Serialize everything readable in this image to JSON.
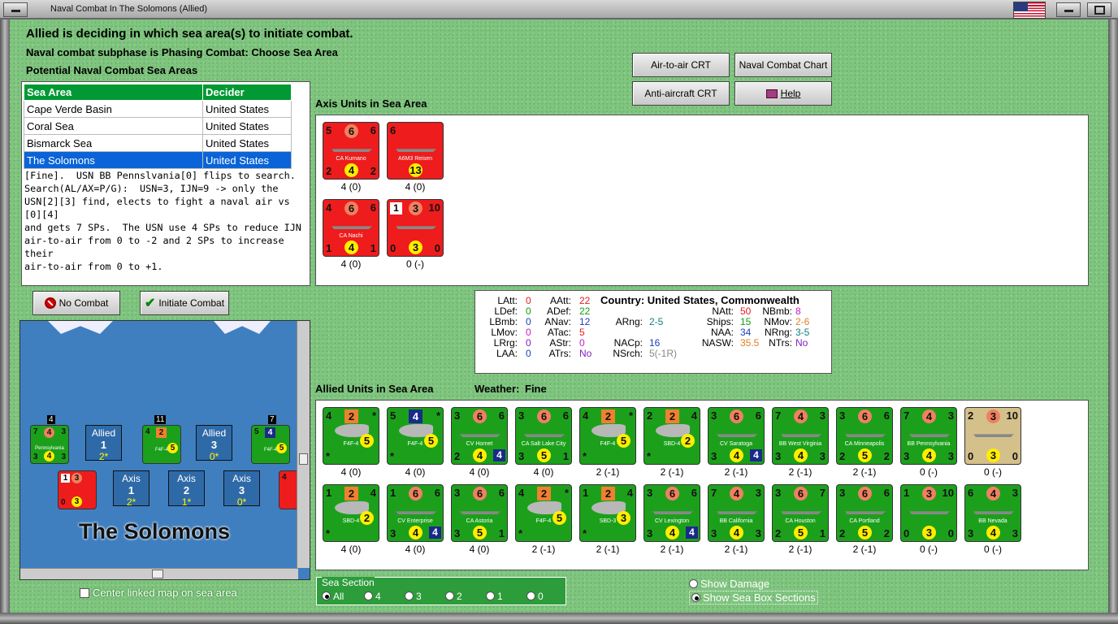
{
  "window": {
    "title": "Naval Combat In The Solomons (Allied)"
  },
  "header": {
    "line1": "Allied is deciding in which sea area(s) to initiate combat.",
    "line2": "Naval combat subphase is Phasing Combat: Choose Sea Area",
    "line3": "Potential Naval Combat Sea Areas"
  },
  "table": {
    "columns": [
      "Sea Area",
      "Decider"
    ],
    "rows": [
      [
        "Cape Verde Basin",
        "United States"
      ],
      [
        "Coral Sea",
        "United States"
      ],
      [
        "Bismarck Sea",
        "United States"
      ],
      [
        "The Solomons",
        "United States"
      ]
    ]
  },
  "description": "[Fine].  USN BB Pennslvania[0] flips to search.\nSearch(AL/AX=P/G):  USN=3, IJN=9 -> only the\nUSN[2][3] find, elects to fight a naval air vs [0][4]\nand gets 7 SPs.  The USN use 4 SPs to reduce IJN\nair-to-air from 0 to -2 and 2 SPs to increase their\nair-to-air from 0 to +1.",
  "buttons": {
    "air_to_air": "Air-to-air CRT",
    "naval_chart": "Naval Combat Chart",
    "anti_aircraft": "Anti-aircraft CRT",
    "help": "Help",
    "no_combat": "No Combat",
    "initiate": "Initiate Combat"
  },
  "axis": {
    "title": "Axis Units in Sea Area",
    "units": [
      {
        "tl": "5",
        "tc": "6",
        "tr": "6",
        "bl": "2",
        "bc": "4",
        "br": "2",
        "name": "CA Kumano",
        "cap": "4 (0)"
      },
      {
        "tl": "6",
        "tc": "",
        "tr": "",
        "bl": "",
        "bc": "13",
        "br": "",
        "name": "A6M3 Reisen",
        "cap": "4 (0)"
      },
      {
        "tl": "4",
        "tc": "6",
        "tr": "6",
        "bl": "1",
        "bc": "4",
        "br": "1",
        "name": "CA Nachi",
        "cap": "4 (0)"
      },
      {
        "tl": "1",
        "tc": "3",
        "tr": "10",
        "bl": "0",
        "bc": "3",
        "br": "0",
        "name": "",
        "cap": "0 (-)"
      }
    ]
  },
  "stats": {
    "country_label": "Country:",
    "country": "United States, Commonwealth",
    "labels": {
      "latt": "LAtt:",
      "ldef": "LDef:",
      "lbmb": "LBmb:",
      "lmov": "LMov:",
      "lrrg": "LRrg:",
      "laa": "LAA:",
      "aatt": "AAtt:",
      "adef": "ADef:",
      "anav": "ANav:",
      "atac": "ATac:",
      "astr": "AStr:",
      "atrs": "ATrs:",
      "arng": "ARng:",
      "nacp": "NACp:",
      "nsrch": "NSrch:",
      "natt": "NAtt:",
      "ships": "Ships:",
      "naa": "NAA:",
      "nasw": "NASW:",
      "nbmb": "NBmb:",
      "nmov": "NMov:",
      "nrng": "NRng:",
      "ntrs": "NTrs:"
    },
    "values": {
      "latt": "0",
      "ldef": "0",
      "lbmb": "0",
      "lmov": "0",
      "lrrg": "0",
      "laa": "0",
      "aatt": "22",
      "adef": "22",
      "anav": "12",
      "atac": "5",
      "astr": "0",
      "atrs": "No",
      "arng": "2-5",
      "nacp": "16",
      "nsrch": "5(-1R)",
      "natt": "50",
      "ships": "15",
      "naa": "34",
      "nasw": "35.5",
      "nbmb": "8",
      "nmov": "2-6",
      "nrng": "3-5",
      "ntrs": "No"
    },
    "colors": {
      "red": "#e02020",
      "green": "#10a010",
      "blue": "#1a3fc0",
      "magenta": "#c020c0",
      "teal": "#108080",
      "orange": "#e08020",
      "purple": "#8020c0",
      "gray": "#888888"
    }
  },
  "allied": {
    "title": "Allied Units in Sea Area",
    "weather_label": "Weather:",
    "weather": "Fine",
    "row1": [
      {
        "tl": "4",
        "tc": "2",
        "tr": "*",
        "bl": "*",
        "bc": "5",
        "br": "",
        "name": "F4F-4",
        "cap": "4 (0)",
        "sq": true,
        "plane": true
      },
      {
        "tl": "5",
        "tc": "4",
        "tr": "*",
        "bl": "*",
        "bc": "5",
        "br": "",
        "name": "F4F-4",
        "cap": "4 (0)",
        "plane": true,
        "blue": true
      },
      {
        "tl": "3",
        "tc": "6",
        "tr": "6",
        "bl": "2",
        "bc": "4",
        "br": "4",
        "name": "CV Hornet",
        "cap": "4 (0)",
        "bsq": "4"
      },
      {
        "tl": "3",
        "tc": "6",
        "tr": "6",
        "bl": "3",
        "bc": "5",
        "br": "1",
        "name": "CA Salt Lake City",
        "cap": "4 (0)"
      },
      {
        "tl": "4",
        "tc": "2",
        "tr": "*",
        "bl": "*",
        "bc": "5",
        "br": "",
        "name": "F4F-4",
        "cap": "2 (-1)",
        "sq": true,
        "plane": true
      },
      {
        "tl": "2",
        "tc": "2",
        "tr": "4",
        "bl": "*",
        "bc": "2",
        "br": "",
        "name": "SBD-4",
        "cap": "2 (-1)",
        "sq": true,
        "plane": true
      },
      {
        "tl": "3",
        "tc": "6",
        "tr": "6",
        "bl": "3",
        "bc": "4",
        "br": "4",
        "name": "CV Saratoga",
        "cap": "2 (-1)",
        "bsq": "4"
      },
      {
        "tl": "7",
        "tc": "4",
        "tr": "3",
        "bl": "3",
        "bc": "4",
        "br": "3",
        "name": "BB West Virginia",
        "cap": "2 (-1)"
      },
      {
        "tl": "3",
        "tc": "6",
        "tr": "6",
        "bl": "2",
        "bc": "5",
        "br": "2",
        "name": "CA Minneapolis",
        "cap": "2 (-1)"
      },
      {
        "tl": "7",
        "tc": "4",
        "tr": "3",
        "bl": "3",
        "bc": "4",
        "br": "3",
        "name": "BB Pennsylvania",
        "cap": "0 (-)"
      },
      {
        "tl": "2",
        "tc": "3",
        "tr": "10",
        "bl": "0",
        "bc": "3",
        "br": "0",
        "name": "",
        "cap": "0 (-)",
        "tan": true
      }
    ],
    "row2": [
      {
        "tl": "1",
        "tc": "2",
        "tr": "4",
        "bl": "*",
        "bc": "2",
        "br": "",
        "name": "SBD-4",
        "cap": "4 (0)",
        "sq": true,
        "plane": true
      },
      {
        "tl": "1",
        "tc": "6",
        "tr": "6",
        "bl": "3",
        "bc": "4",
        "br": "4",
        "name": "CV Enterprise",
        "cap": "4 (0)",
        "bsq": "4"
      },
      {
        "tl": "3",
        "tc": "6",
        "tr": "6",
        "bl": "3",
        "bc": "5",
        "br": "1",
        "name": "CA Astoria",
        "cap": "4 (0)"
      },
      {
        "tl": "4",
        "tc": "2",
        "tr": "*",
        "bl": "*",
        "bc": "5",
        "br": "",
        "name": "F4F-4",
        "cap": "2 (-1)",
        "sq": true,
        "plane": true
      },
      {
        "tl": "1",
        "tc": "2",
        "tr": "4",
        "bl": "*",
        "bc": "3",
        "br": "",
        "name": "SBD-3",
        "cap": "2 (-1)",
        "sq": true,
        "plane": true
      },
      {
        "tl": "3",
        "tc": "6",
        "tr": "6",
        "bl": "3",
        "bc": "4",
        "br": "4",
        "name": "CV Lexington",
        "cap": "2 (-1)",
        "bsq": "4"
      },
      {
        "tl": "7",
        "tc": "4",
        "tr": "3",
        "bl": "3",
        "bc": "4",
        "br": "3",
        "name": "BB California",
        "cap": "2 (-1)"
      },
      {
        "tl": "3",
        "tc": "6",
        "tr": "7",
        "bl": "2",
        "bc": "5",
        "br": "1",
        "name": "CA Houston",
        "cap": "2 (-1)"
      },
      {
        "tl": "3",
        "tc": "6",
        "tr": "6",
        "bl": "2",
        "bc": "5",
        "br": "2",
        "name": "CA Portland",
        "cap": "2 (-1)"
      },
      {
        "tl": "1",
        "tc": "3",
        "tr": "10",
        "bl": "0",
        "bc": "3",
        "br": "0",
        "name": "",
        "cap": "0 (-)"
      },
      {
        "tl": "6",
        "tc": "4",
        "tr": "3",
        "bl": "3",
        "bc": "4",
        "br": "3",
        "name": "BB Nevada",
        "cap": "0 (-)"
      }
    ]
  },
  "map": {
    "area": "The Solomons",
    "allied_boxes": [
      {
        "t": "Allied",
        "n": "1",
        "s": "2*"
      },
      {
        "t": "Allied",
        "n": "3",
        "s": "0*"
      }
    ],
    "axis_boxes": [
      {
        "t": "Axis",
        "n": "1",
        "s": "2*"
      },
      {
        "t": "Axis",
        "n": "2",
        "s": "1*"
      },
      {
        "t": "Axis",
        "n": "3",
        "s": "0*"
      }
    ],
    "stack_counts": [
      "4",
      "11",
      "7"
    ],
    "mini_label": "Pennsylvania",
    "mini_label2": "F4F-4"
  },
  "center_map_label": "Center linked map on sea area",
  "sea_section": {
    "title": "Sea Section",
    "options": [
      "All",
      "4",
      "3",
      "2",
      "1",
      "0"
    ]
  },
  "options": {
    "show_damage": "Show Damage",
    "show_sections": "Show Sea Box Sections"
  }
}
